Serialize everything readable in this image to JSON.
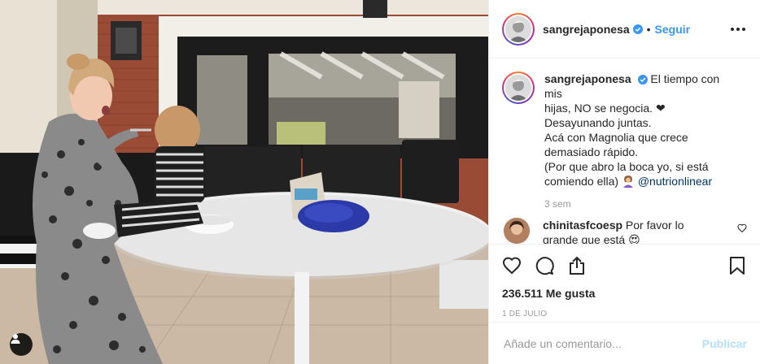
{
  "post": {
    "username": "sangrejaponesa",
    "follow_label": "Seguir",
    "separator": "•",
    "caption_lines": [
      "El tiempo con mis",
      "hijas, NO se negocia. ❤",
      "Desayunando juntas.",
      "Acá con Magnolia que crece",
      "demasiado rápido.",
      "(Por que abro la boca yo, si está",
      "comiendo ella)"
    ],
    "mention": "@nutrionlinear",
    "time_ago": "3 sem",
    "likes": "236.511 Me gusta",
    "date": "1 DE JULIO"
  },
  "comments": [
    {
      "username": "chinitasfcoesp",
      "text": "Por favor lo grande que está",
      "emoji": "😍"
    }
  ],
  "input": {
    "placeholder": "Añade un comentario...",
    "publish_label": "Publicar"
  },
  "icons": {
    "verified": "verified-badge-icon",
    "more": "more-options-icon",
    "like": "heart-outline-icon",
    "comment": "comment-bubble-icon",
    "share": "share-icon",
    "save": "bookmark-icon",
    "tag": "user-tag-icon"
  },
  "colors": {
    "accent": "#3897f0",
    "verified": "#3897f0",
    "muted": "#999999",
    "publish_disabled": "#b2dffc",
    "text": "#262626",
    "mention": "#003569"
  }
}
